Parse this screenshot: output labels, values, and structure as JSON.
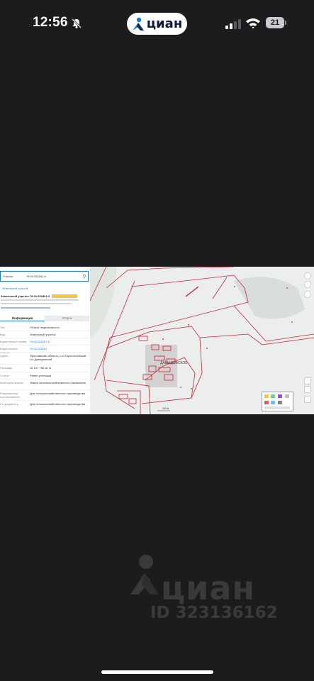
{
  "status": {
    "time": "12:56",
    "app_pill": "циан",
    "battery": "21"
  },
  "screenshot": {
    "panel": {
      "search_type": "Участки",
      "search_number": "76:02:051801:6",
      "breadcrumb": "Земельный участок",
      "title": "Земельный участок 76:02:051801:6",
      "tabs": [
        "Информация",
        "Услуги"
      ],
      "rows": [
        {
          "k": "Тип",
          "v": "Объект недвижимости"
        },
        {
          "k": "Вид",
          "v": "Земельный участок"
        },
        {
          "k": "Кадастровый номер",
          "v": "76:02:051801:6"
        },
        {
          "k": "Кадастровый квартал",
          "v": "76:02:051801"
        },
        {
          "k": "Адрес",
          "v": "Ярославская область, р-н Борисоглебский, с/о Давыдовский"
        },
        {
          "k": "Площадь",
          "v": "18 137 786 кв. м"
        },
        {
          "k": "Статус",
          "v": "Ранее учтенный"
        },
        {
          "k": "Категория земель",
          "v": "Земли сельскохозяйственного назначения"
        },
        {
          "k": "Разрешенное использование",
          "v": "Для сельскохозяйственного производства"
        },
        {
          "k": "По документу",
          "v": "Для сельскохозяйственного производства"
        }
      ]
    },
    "map": {
      "village_label": "ДАВЫДОВСКОЕ",
      "scale_label": "300 м"
    }
  },
  "watermark": {
    "word": "циан",
    "id": "ID 323136162"
  },
  "colors": {
    "background": "#1c1c1e",
    "boundary": "#d0202c",
    "accent": "#1f7bd6"
  }
}
